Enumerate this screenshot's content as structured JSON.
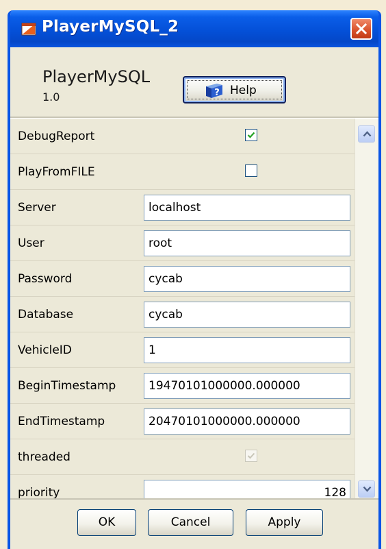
{
  "window": {
    "title": "PlayerMySQL_2",
    "app_name": "PlayerMySQL",
    "version": "1.0",
    "help_label": "Help"
  },
  "properties": [
    {
      "label": "DebugReport",
      "type": "checkbox",
      "checked": true,
      "enabled": true
    },
    {
      "label": "PlayFromFILE",
      "type": "checkbox",
      "checked": false,
      "enabled": true
    },
    {
      "label": "Server",
      "type": "text",
      "value": "localhost"
    },
    {
      "label": "User",
      "type": "text",
      "value": "root"
    },
    {
      "label": "Password",
      "type": "text",
      "value": "cycab"
    },
    {
      "label": "Database",
      "type": "text",
      "value": "cycab"
    },
    {
      "label": "VehicleID",
      "type": "text",
      "value": "1"
    },
    {
      "label": "BeginTimestamp",
      "type": "text",
      "value": "19470101000000.000000"
    },
    {
      "label": "EndTimestamp",
      "type": "text",
      "value": "20470101000000.000000"
    },
    {
      "label": "threaded",
      "type": "checkbox",
      "checked": true,
      "enabled": false
    },
    {
      "label": "priority",
      "type": "number",
      "value": "128"
    }
  ],
  "buttons": {
    "ok": "OK",
    "cancel": "Cancel",
    "apply": "Apply"
  },
  "colors": {
    "titlebar": "#0450d8",
    "window_bg": "#ece9d8",
    "close_button": "#d8502a",
    "check_mark": "#21a121"
  },
  "icons": {
    "title": "java-window-icon",
    "close": "close-icon",
    "help": "help-book-icon",
    "scroll_up": "chevron-up-icon",
    "scroll_down": "chevron-down-icon"
  }
}
